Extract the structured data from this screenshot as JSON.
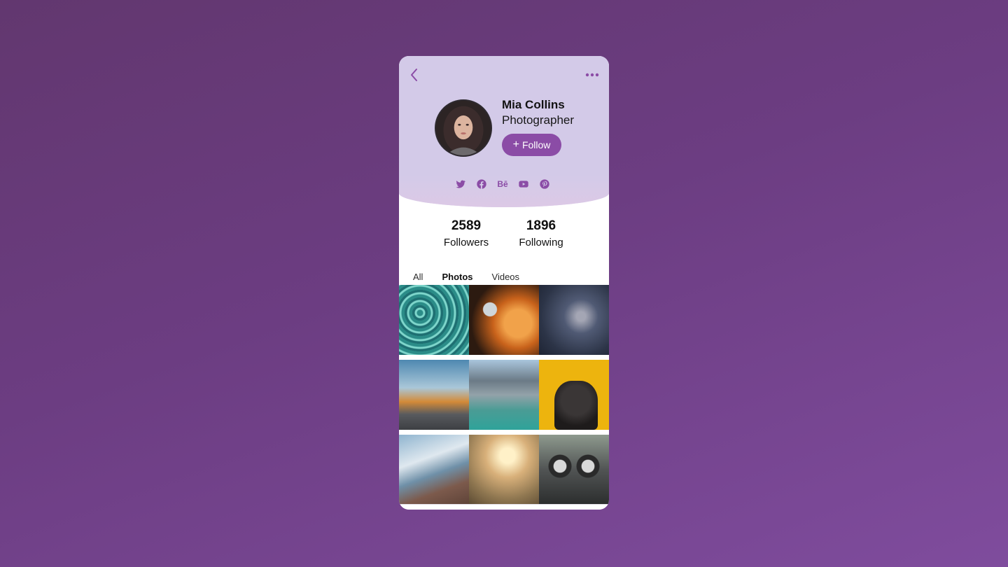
{
  "colors": {
    "accent": "#8b4ca6",
    "header_bg": "#d3cae8",
    "background": "#6c3d82"
  },
  "nav": {
    "back_icon": "chevron-left-icon",
    "more_icon": "more-horizontal-icon"
  },
  "profile": {
    "name": "Mia Collins",
    "role": "Photographer",
    "follow_label": "Follow",
    "follow_icon": "plus-icon"
  },
  "socials": [
    {
      "icon": "twitter-icon"
    },
    {
      "icon": "facebook-icon"
    },
    {
      "icon": "behance-icon",
      "label": "Bē"
    },
    {
      "icon": "youtube-icon"
    },
    {
      "icon": "pinterest-icon"
    }
  ],
  "stats": {
    "followers_value": "2589",
    "followers_label": "Followers",
    "following_value": "1896",
    "following_label": "Following"
  },
  "tabs": [
    {
      "label": "All",
      "active": false
    },
    {
      "label": "Photos",
      "active": true
    },
    {
      "label": "Videos",
      "active": false
    }
  ],
  "gallery": [
    {
      "subject": "pool-water"
    },
    {
      "subject": "campfire-marshmallow"
    },
    {
      "subject": "storm-clouds"
    },
    {
      "subject": "autumn-road"
    },
    {
      "subject": "mountain-lake"
    },
    {
      "subject": "pug-dog"
    },
    {
      "subject": "sailboat-deck"
    },
    {
      "subject": "golden-grass"
    },
    {
      "subject": "vintage-car"
    }
  ]
}
